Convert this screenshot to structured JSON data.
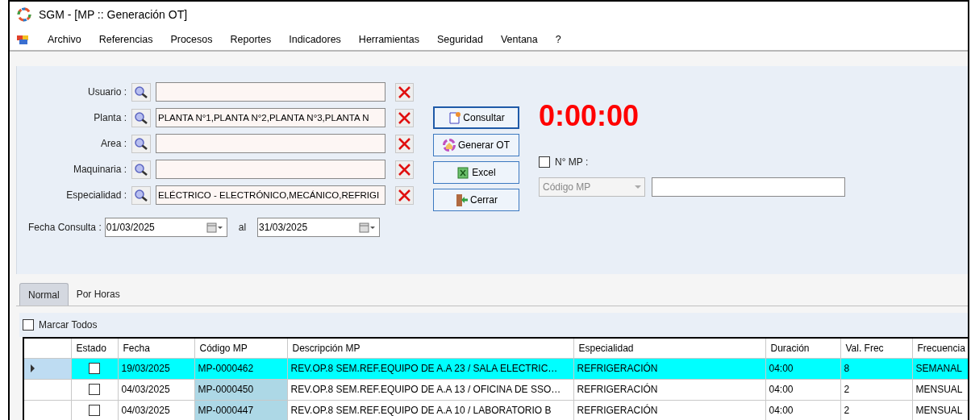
{
  "window": {
    "title": "SGM - [MP :: Generación OT]"
  },
  "menu": [
    "Archivo",
    "Referencias",
    "Procesos",
    "Reportes",
    "Indicadores",
    "Herramientas",
    "Seguridad",
    "Ventana",
    "?"
  ],
  "filters": [
    {
      "label": "Usuario :"
    },
    {
      "label": "Planta :",
      "value": "PLANTA N°1,PLANTA N°2,PLANTA N°3,PLANTA N"
    },
    {
      "label": "Area :"
    },
    {
      "label": "Maquinaria :"
    },
    {
      "label": "Especialidad :",
      "value": "ELÉCTRICO - ELECTRÓNICO,MECÁNICO,REFRIGI"
    }
  ],
  "date_filter": {
    "label": "Fecha Consulta :",
    "from": "01/03/2025",
    "separator": "al",
    "to": "31/03/2025"
  },
  "buttons": [
    {
      "label": "Consultar",
      "kind": "query",
      "focused": true
    },
    {
      "label": "Generar OT",
      "kind": "generate",
      "focused": false
    },
    {
      "label": "Excel",
      "kind": "excel",
      "focused": false
    },
    {
      "label": "Cerrar",
      "kind": "close",
      "focused": false
    }
  ],
  "timer": "0:00:00",
  "mp_number": {
    "label": "N° MP :",
    "checked": false,
    "dropdown": "Código MP"
  },
  "tabs": [
    {
      "label": "Normal",
      "selected": true
    },
    {
      "label": "Por Horas",
      "selected": false
    }
  ],
  "select_all": {
    "label": "Marcar Todos",
    "checked": false
  },
  "table": {
    "columns": [
      {
        "label": "Estado",
        "shaded": false
      },
      {
        "label": "Fecha",
        "shaded": false
      },
      {
        "label": "Código MP",
        "shaded": true
      },
      {
        "label": "Descripción MP",
        "shaded": false
      },
      {
        "label": "Especialidad",
        "shaded": false
      },
      {
        "label": "Duración",
        "shaded": false
      },
      {
        "label": "Val. Frec",
        "shaded": false
      },
      {
        "label": "Frecuencia",
        "shaded": false
      }
    ],
    "rows": [
      {
        "current": true,
        "checked": false,
        "cells": [
          "",
          "19/03/2025",
          "MP-0000462",
          "REV.OP.8 SEM.REF.EQUIPO DE A.A 23 / SALA ELECTRIC…",
          "REFRIGERACIÓN",
          "04:00",
          "8",
          "SEMANAL"
        ]
      },
      {
        "current": false,
        "checked": false,
        "cells": [
          "",
          "04/03/2025",
          "MP-0000450",
          "REV.OP.8 SEM.REF.EQUIPO DE A.A 13 / OFICINA DE SSO…",
          "REFRIGERACIÓN",
          "04:00",
          "2",
          "MENSUAL"
        ]
      },
      {
        "current": false,
        "checked": false,
        "cells": [
          "",
          "04/03/2025",
          "MP-0000447",
          "REV.OP.8 SEM.REF.EQUIPO DE A.A 10 / LABORATORIO B",
          "REFRIGERACIÓN",
          "04:00",
          "2",
          "MENSUAL"
        ]
      }
    ]
  }
}
